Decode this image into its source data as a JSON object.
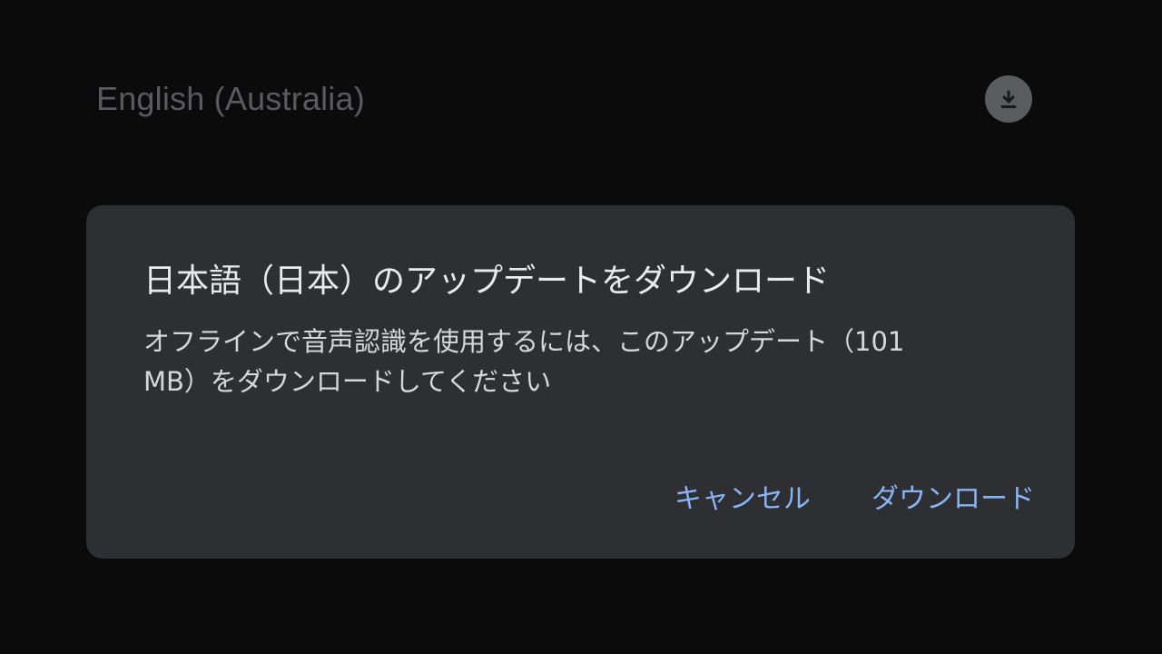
{
  "background_row": {
    "language_name": "English (Australia)",
    "download_icon": "download-icon"
  },
  "dialog": {
    "title": "日本語（日本）のアップデートをダウンロード",
    "body_line1": "オフラインで音声認識を使用するには、このアップデート（101",
    "body_line2": "MB）をダウンロードしてください",
    "cancel_label": "キャンセル",
    "download_label": "ダウンロード"
  },
  "colors": {
    "background": "#0b0b0c",
    "dialog_surface": "#2e2f33",
    "dimmed_text": "#5a5b5e",
    "accent": "#8ab4f8",
    "title_text": "#e8eaed"
  }
}
